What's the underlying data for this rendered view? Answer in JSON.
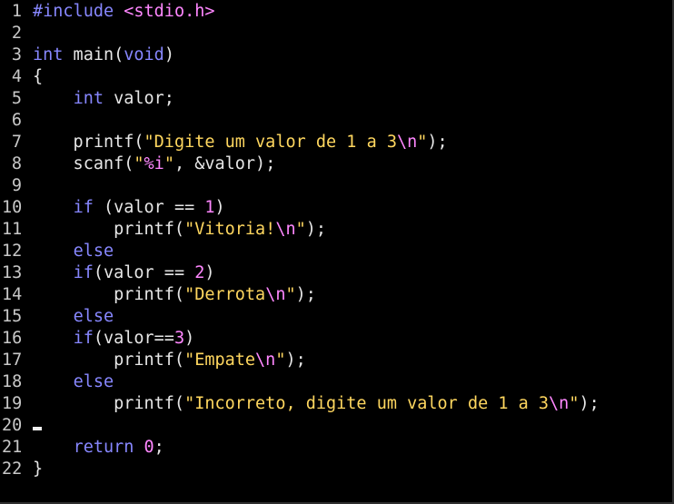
{
  "editor": {
    "lines": [
      {
        "num": "1",
        "tokens": [
          {
            "t": "#include ",
            "k": "preproc"
          },
          {
            "t": "<stdio.h>",
            "k": "include"
          }
        ]
      },
      {
        "num": "2",
        "tokens": []
      },
      {
        "num": "3",
        "tokens": [
          {
            "t": "int",
            "k": "keyword"
          },
          {
            "t": " main(",
            "k": "plain"
          },
          {
            "t": "void",
            "k": "keyword"
          },
          {
            "t": ")",
            "k": "plain"
          }
        ]
      },
      {
        "num": "4",
        "tokens": [
          {
            "t": "{",
            "k": "plain"
          }
        ]
      },
      {
        "num": "5",
        "tokens": [
          {
            "t": "    ",
            "k": "plain"
          },
          {
            "t": "int",
            "k": "keyword"
          },
          {
            "t": " valor;",
            "k": "plain"
          }
        ]
      },
      {
        "num": "6",
        "tokens": []
      },
      {
        "num": "7",
        "tokens": [
          {
            "t": "    printf(",
            "k": "plain"
          },
          {
            "t": "\"Digite um valor de 1 a 3",
            "k": "string"
          },
          {
            "t": "\\n",
            "k": "escape"
          },
          {
            "t": "\"",
            "k": "string"
          },
          {
            "t": ");",
            "k": "plain"
          }
        ]
      },
      {
        "num": "8",
        "tokens": [
          {
            "t": "    scanf(",
            "k": "plain"
          },
          {
            "t": "\"",
            "k": "string"
          },
          {
            "t": "%i",
            "k": "format"
          },
          {
            "t": "\"",
            "k": "string"
          },
          {
            "t": ", &valor);",
            "k": "plain"
          }
        ]
      },
      {
        "num": "9",
        "tokens": []
      },
      {
        "num": "10",
        "tokens": [
          {
            "t": "    ",
            "k": "plain"
          },
          {
            "t": "if",
            "k": "keyword"
          },
          {
            "t": " (valor == ",
            "k": "plain"
          },
          {
            "t": "1",
            "k": "number"
          },
          {
            "t": ")",
            "k": "plain"
          }
        ]
      },
      {
        "num": "11",
        "tokens": [
          {
            "t": "        printf(",
            "k": "plain"
          },
          {
            "t": "\"Vitoria!",
            "k": "string"
          },
          {
            "t": "\\n",
            "k": "escape"
          },
          {
            "t": "\"",
            "k": "string"
          },
          {
            "t": ");",
            "k": "plain"
          }
        ]
      },
      {
        "num": "12",
        "tokens": [
          {
            "t": "    ",
            "k": "plain"
          },
          {
            "t": "else",
            "k": "keyword"
          }
        ]
      },
      {
        "num": "13",
        "tokens": [
          {
            "t": "    ",
            "k": "plain"
          },
          {
            "t": "if",
            "k": "keyword"
          },
          {
            "t": "(valor == ",
            "k": "plain"
          },
          {
            "t": "2",
            "k": "number"
          },
          {
            "t": ")",
            "k": "plain"
          }
        ]
      },
      {
        "num": "14",
        "tokens": [
          {
            "t": "        printf(",
            "k": "plain"
          },
          {
            "t": "\"Derrota",
            "k": "string"
          },
          {
            "t": "\\n",
            "k": "escape"
          },
          {
            "t": "\"",
            "k": "string"
          },
          {
            "t": ");",
            "k": "plain"
          }
        ]
      },
      {
        "num": "15",
        "tokens": [
          {
            "t": "    ",
            "k": "plain"
          },
          {
            "t": "else",
            "k": "keyword"
          }
        ]
      },
      {
        "num": "16",
        "tokens": [
          {
            "t": "    ",
            "k": "plain"
          },
          {
            "t": "if",
            "k": "keyword"
          },
          {
            "t": "(valor==",
            "k": "plain"
          },
          {
            "t": "3",
            "k": "number"
          },
          {
            "t": ")",
            "k": "plain"
          }
        ]
      },
      {
        "num": "17",
        "tokens": [
          {
            "t": "        printf(",
            "k": "plain"
          },
          {
            "t": "\"Empate",
            "k": "string"
          },
          {
            "t": "\\n",
            "k": "escape"
          },
          {
            "t": "\"",
            "k": "string"
          },
          {
            "t": ");",
            "k": "plain"
          }
        ]
      },
      {
        "num": "18",
        "tokens": [
          {
            "t": "    ",
            "k": "plain"
          },
          {
            "t": "else",
            "k": "keyword"
          }
        ]
      },
      {
        "num": "19",
        "tokens": [
          {
            "t": "        printf(",
            "k": "plain"
          },
          {
            "t": "\"Incorreto, digite um valor de 1 a 3",
            "k": "string"
          },
          {
            "t": "\\n",
            "k": "escape"
          },
          {
            "t": "\"",
            "k": "string"
          },
          {
            "t": ");",
            "k": "plain"
          }
        ]
      },
      {
        "num": "20",
        "tokens": [],
        "cursor": true
      },
      {
        "num": "21",
        "tokens": [
          {
            "t": "    ",
            "k": "plain"
          },
          {
            "t": "return",
            "k": "keyword"
          },
          {
            "t": " ",
            "k": "plain"
          },
          {
            "t": "0",
            "k": "number"
          },
          {
            "t": ";",
            "k": "plain"
          }
        ]
      },
      {
        "num": "22",
        "tokens": [
          {
            "t": "}",
            "k": "plain"
          }
        ]
      }
    ]
  }
}
